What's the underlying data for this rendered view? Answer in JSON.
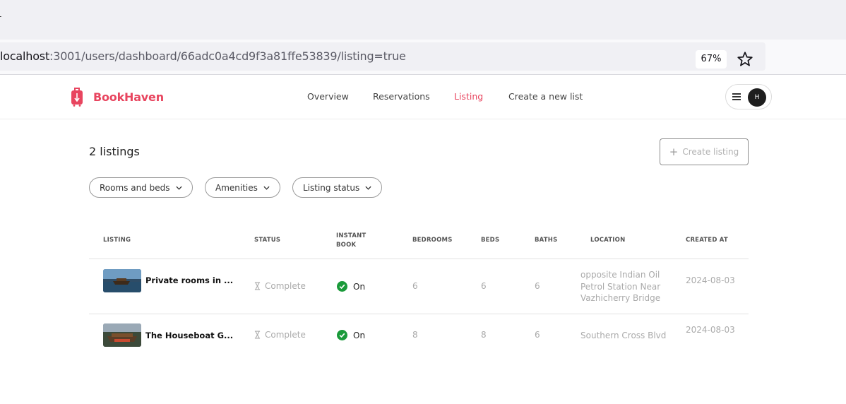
{
  "browser": {
    "url_host": "localhost",
    "url_path": ":3001/users/dashboard/66adc0a4cd9f3a81ffe53839/listing=true",
    "zoom": "67%",
    "star_icon": "star-icon"
  },
  "header": {
    "brand": "BookHaven",
    "brand_color": "#e8455f",
    "nav": {
      "overview": "Overview",
      "reservations": "Reservations",
      "listing": "Listing",
      "create": "Create a new list"
    },
    "avatar_initial": "H"
  },
  "main": {
    "count_label": "2 listings",
    "create_button": "Create listing",
    "filters": {
      "rooms": "Rooms and beds",
      "amenities": "Amenities",
      "status": "Listing status"
    }
  },
  "table": {
    "headers": {
      "listing": "LISTING",
      "status": "STATUS",
      "instant_1": "INSTANT",
      "instant_2": "BOOK",
      "bedrooms": "BEDROOMS",
      "beds": "BEDS",
      "baths": "BATHS",
      "location": "LOCATION",
      "created": "CREATED AT"
    },
    "rows": [
      {
        "name": "Private rooms in ...",
        "status": "Complete",
        "instant": "On",
        "bedrooms": "6",
        "beds": "6",
        "baths": "6",
        "location": "opposite Indian Oil Petrol Station Near Vazhicherry Bridge",
        "created": "2024-08-03"
      },
      {
        "name": "The Houseboat G...",
        "status": "Complete",
        "instant": "On",
        "bedrooms": "8",
        "beds": "8",
        "baths": "6",
        "location": "Southern Cross Blvd",
        "created": "2024-08-03"
      }
    ]
  },
  "colors": {
    "accent": "#e8455f",
    "on_green": "#1a9a3a"
  }
}
